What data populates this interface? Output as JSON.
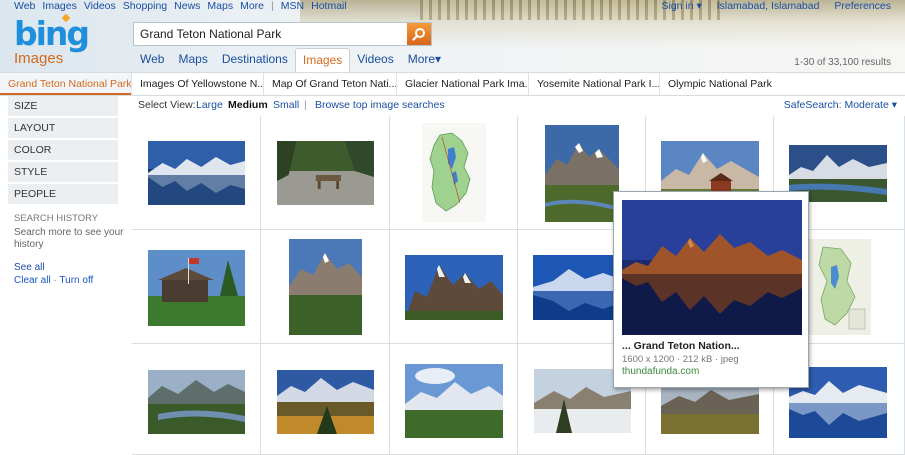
{
  "top_nav": {
    "links": [
      "Web",
      "Images",
      "Videos",
      "Shopping",
      "News",
      "Maps",
      "More"
    ],
    "separator": "|",
    "msn": "MSN",
    "hotmail": "Hotmail"
  },
  "top_right": {
    "sign_in": "Sign in ▾",
    "location": "Islamabad, Islamabad",
    "preferences": "Preferences"
  },
  "logo": {
    "text": "bing",
    "accent_color": "#1f8fdc",
    "dot_color": "#f5a623"
  },
  "vertical_label": "Images",
  "search": {
    "value": "Grand Teton National Park",
    "button_icon": "search-icon"
  },
  "scopes": {
    "web": "Web",
    "maps": "Maps",
    "destinations": "Destinations",
    "images": "Images",
    "videos": "Videos",
    "more": "More▾",
    "active": "Images"
  },
  "result_count": "1-30 of 33,100 results",
  "related_searches": [
    "Grand Teton National Park",
    "Images Of Yellowstone N...",
    "Map Of Grand Teton Nati...",
    "Glacier National Park Ima...",
    "Yosemite National Park I...",
    "Olympic National Park"
  ],
  "filters": [
    "SIZE",
    "LAYOUT",
    "COLOR",
    "STYLE",
    "PEOPLE"
  ],
  "search_history": {
    "heading": "SEARCH HISTORY",
    "text": "Search more to see your history",
    "see_all": "See all",
    "clear_all": "Clear all",
    "dot": "·",
    "turn_off": "Turn off"
  },
  "view_bar": {
    "label": "Select View:",
    "large": "Large",
    "medium": "Medium",
    "small": "Small",
    "separator": "|",
    "browse": "Browse top image searches",
    "safesearch": "SafeSearch: Moderate ▾"
  },
  "hover_card": {
    "title": "... Grand Teton Nation...",
    "meta": "1600 x 1200 · 212 kB · jpeg",
    "source": "thundafunda.com"
  },
  "colors": {
    "accent_orange": "#d2691e",
    "link_blue": "#1a4fa0",
    "source_green": "#3a8a3a"
  }
}
